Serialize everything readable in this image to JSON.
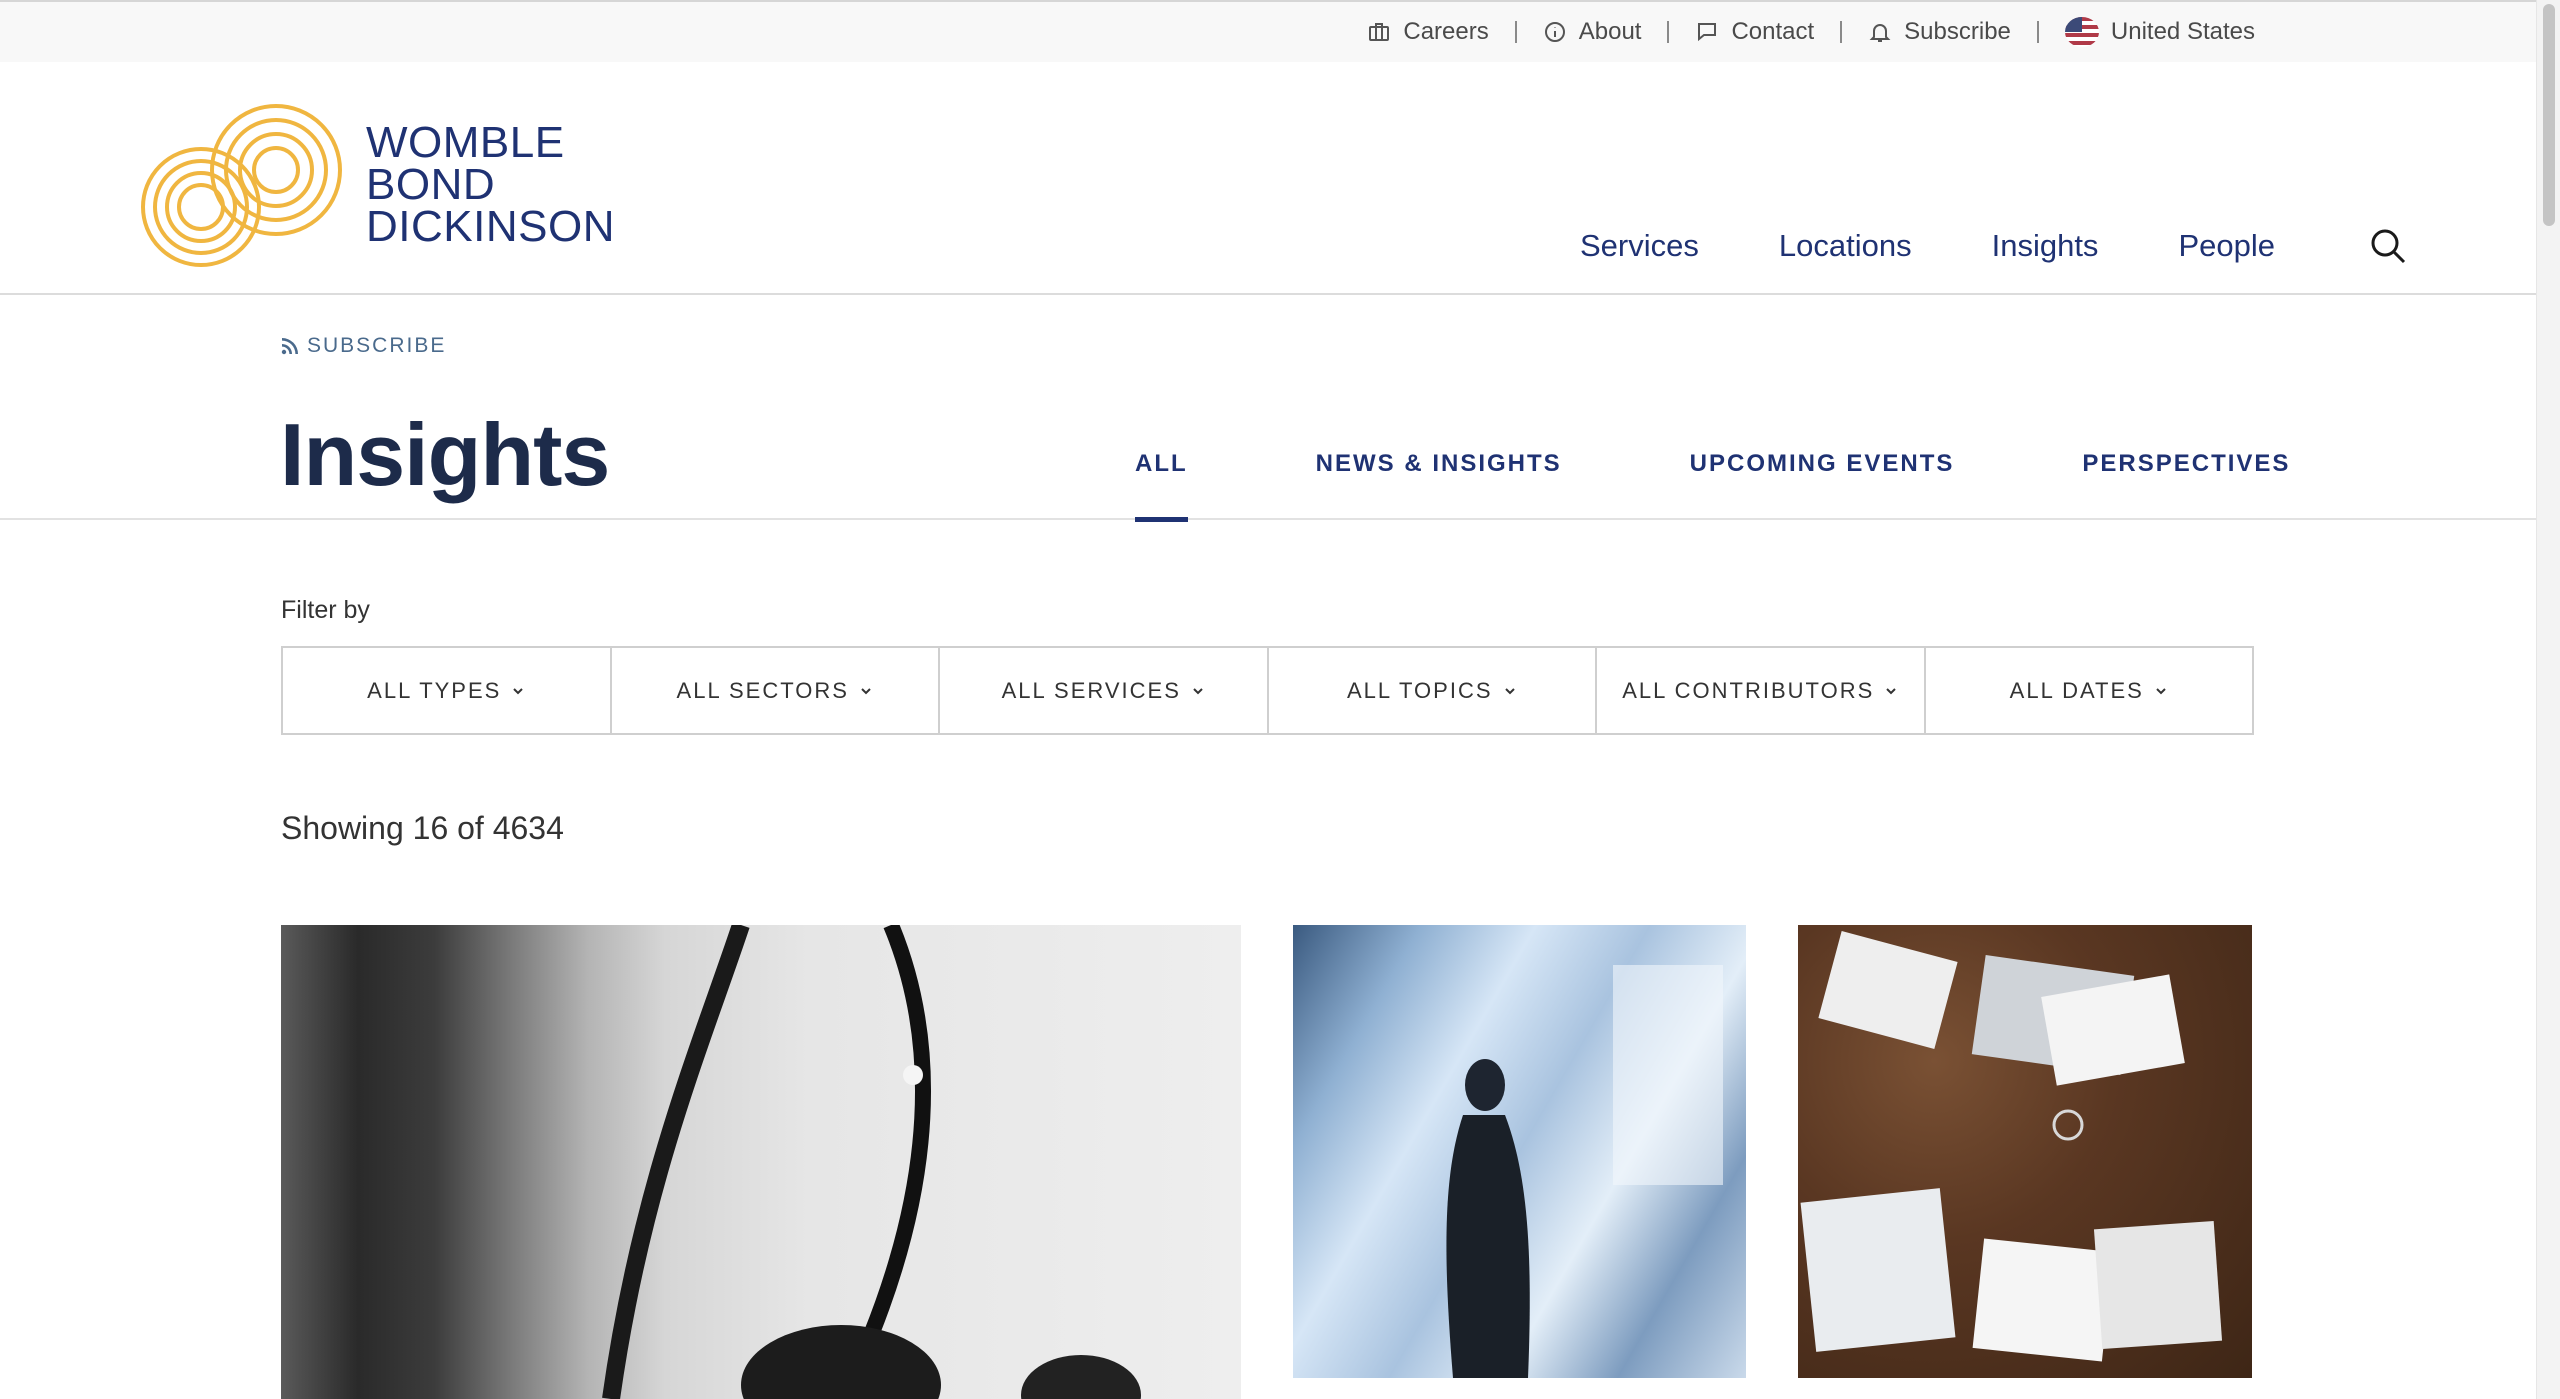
{
  "utility_nav": {
    "items": [
      {
        "label": "Careers",
        "icon": "briefcase-icon"
      },
      {
        "label": "About",
        "icon": "info-icon"
      },
      {
        "label": "Contact",
        "icon": "chat-icon"
      },
      {
        "label": "Subscribe",
        "icon": "bell-icon"
      },
      {
        "label": "United States",
        "icon": "us-flag-icon"
      }
    ]
  },
  "logo": {
    "line1": "WOMBLE",
    "line2": "BOND",
    "line3": "DICKINSON",
    "accent_color": "#f0b640",
    "brand_color": "#1f3273"
  },
  "main_nav": {
    "items": [
      "Services",
      "Locations",
      "Insights",
      "People"
    ]
  },
  "subscribe_link": "SUBSCRIBE",
  "page": {
    "title": "Insights",
    "tabs": [
      {
        "label": "ALL",
        "active": true
      },
      {
        "label": "NEWS & INSIGHTS",
        "active": false
      },
      {
        "label": "UPCOMING EVENTS",
        "active": false
      },
      {
        "label": "PERSPECTIVES",
        "active": false
      }
    ]
  },
  "filter": {
    "label": "Filter by",
    "options": [
      "ALL TYPES",
      "ALL SECTORS",
      "ALL SERVICES",
      "ALL TOPICS",
      "ALL CONTRIBUTORS",
      "ALL DATES"
    ]
  },
  "results": {
    "showing_text": "Showing 16 of 4634"
  }
}
